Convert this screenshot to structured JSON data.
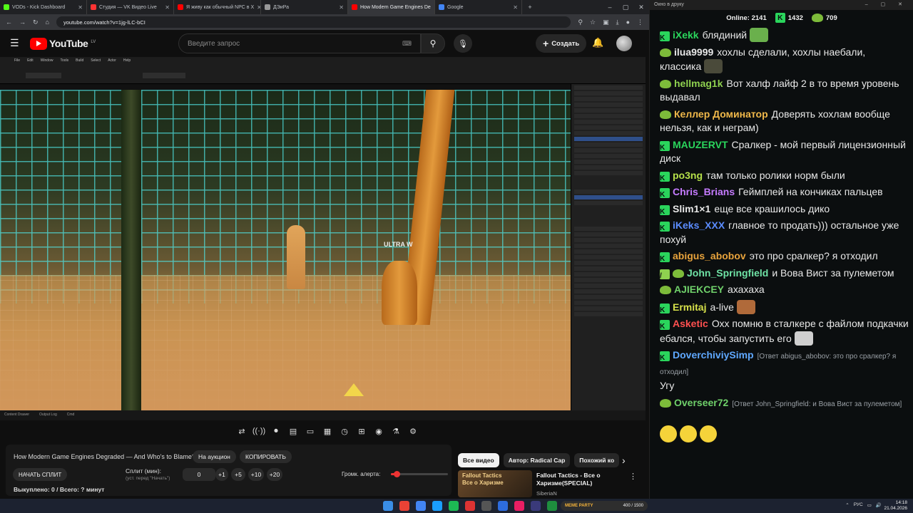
{
  "browser": {
    "tabs": [
      {
        "title": "VODs - Kick Dashboard",
        "color": "#53fc18"
      },
      {
        "title": "Студия — VK Видео Live",
        "color": "#ff3333"
      },
      {
        "title": "Я живу как обычный NPC в Х",
        "color": "#ff0000"
      },
      {
        "title": "ДЭиРа",
        "color": "#999999"
      },
      {
        "title": "How Modern Game Engines De",
        "color": "#ff0000",
        "active": true
      },
      {
        "title": "Google",
        "color": "#4285f4"
      }
    ],
    "url": "youtube.com/watch?v=1jg-lLC-bCI"
  },
  "youtube": {
    "logo": "YouTube",
    "region": "LV",
    "search_placeholder": "Введите запрос",
    "create_label": "Создать"
  },
  "video": {
    "overlay_text": "ULTRA W"
  },
  "tool": {
    "video_title": "How Modern Game Engines Degraded — And Who's to Blame?",
    "auction_label": "На аукцион",
    "copy_label": "КОПИРОВАТЬ",
    "start_split_label": "НАЧАТЬ СПЛИТ",
    "split_label": "Сплит (мин):",
    "split_hint": "(уст. перед \"Начать\")",
    "split_value": "0",
    "plus1": "+1",
    "plus5": "+5",
    "plus10": "+10",
    "plus20": "+20",
    "alert_volume_label": "Громк. алерта:",
    "alert_volume": 0.1,
    "paid_out": "Выкуплено: 0 / Всего: ? минут"
  },
  "related": {
    "chips": [
      "Все видео",
      "Автор: Radical Cap",
      "Похожий ко"
    ],
    "item": {
      "thumb_text": "Fallout Tactics\nВсе о Харизме",
      "title": "Fallout Tactics - Все о Харизме(SPECIAL)",
      "channel": "SiberiaN"
    }
  },
  "chat": {
    "window_title": "Окно в друку",
    "online_label": "Online:",
    "online_count": "2141",
    "k_count": "1432",
    "pepe_count": "709",
    "messages": [
      {
        "user": "iXekk",
        "color": "#2ad55c",
        "text": "блядиний",
        "badge": "k",
        "emote": "#6ab04c"
      },
      {
        "user": "ilua9999",
        "color": "#e8e8e8",
        "text": "хохлы сделали, хохлы наебали, классика",
        "badge": "pepe",
        "emote": "#4a4a3a"
      },
      {
        "user": "hellmag1k",
        "color": "#8fd14f",
        "text": "Вот халф лайф 2 в то время уровень выдавал",
        "badge": "pepe"
      },
      {
        "user": "Келлер Доминатор",
        "color": "#f0b84a",
        "text": "Доверять хохлам вообще нельзя, как и неграм)",
        "badge": "pepe"
      },
      {
        "user": "MAUZERVT",
        "color": "#2ad55c",
        "text": "Сралкер - мой первый лицензионный диск",
        "badge": "k"
      },
      {
        "user": "po3ng",
        "color": "#b6e04a",
        "text": "там только ролики норм были",
        "badge": "k"
      },
      {
        "user": "Chris_Brians",
        "color": "#c57bff",
        "text": "Геймплей на кончиках пальцев",
        "badge": "k"
      },
      {
        "user": "Slim1×1",
        "color": "#e8e8e8",
        "text": "еще все крашилось дико",
        "badge": "k"
      },
      {
        "user": "iKeks_XXX",
        "color": "#5b8cff",
        "text": "главное то продать))) остальное уже похуй",
        "badge": "k"
      },
      {
        "user": "abigus_abobov",
        "color": "#e8a33c",
        "text": "это про сралкер? я отходил",
        "badge": "k"
      },
      {
        "user": "John_Springfield",
        "color": "#6fe3a6",
        "text": "и Вова Вист за пулеметом",
        "badge": "pepe2"
      },
      {
        "user": "AJIEKCEY",
        "color": "#6fd06a",
        "text": "ахахаха",
        "badge": "pepe"
      },
      {
        "user": "Ermitaj",
        "color": "#d6e04a",
        "text": "a-live",
        "badge": "k",
        "emote": "#b06a3a"
      },
      {
        "user": "Asketic",
        "color": "#ff5050",
        "text": "Охх помню в сталкере с файлом подкачки ебался, чтобы запустить его",
        "badge": "k",
        "emote": "#cfcfcf"
      },
      {
        "user": "DoverchiviySimp",
        "color": "#5fa8ff",
        "reply": "[Ответ abigus_abobov: это про сралкер? я отходил]",
        "text": "Угу",
        "badge": "k"
      },
      {
        "user": "Overseer72",
        "color": "#6fd06a",
        "reply": "[Ответ John_Springfield: и Вова Вист за пулеметом]",
        "text": "",
        "badge": "pepe",
        "emotes3": true
      }
    ]
  },
  "taskbar": {
    "lang": "РУС",
    "time": "14:18",
    "date": "21.04.2026",
    "hype_label": "MEME PARTY",
    "hype_value": "400 / 1500"
  }
}
